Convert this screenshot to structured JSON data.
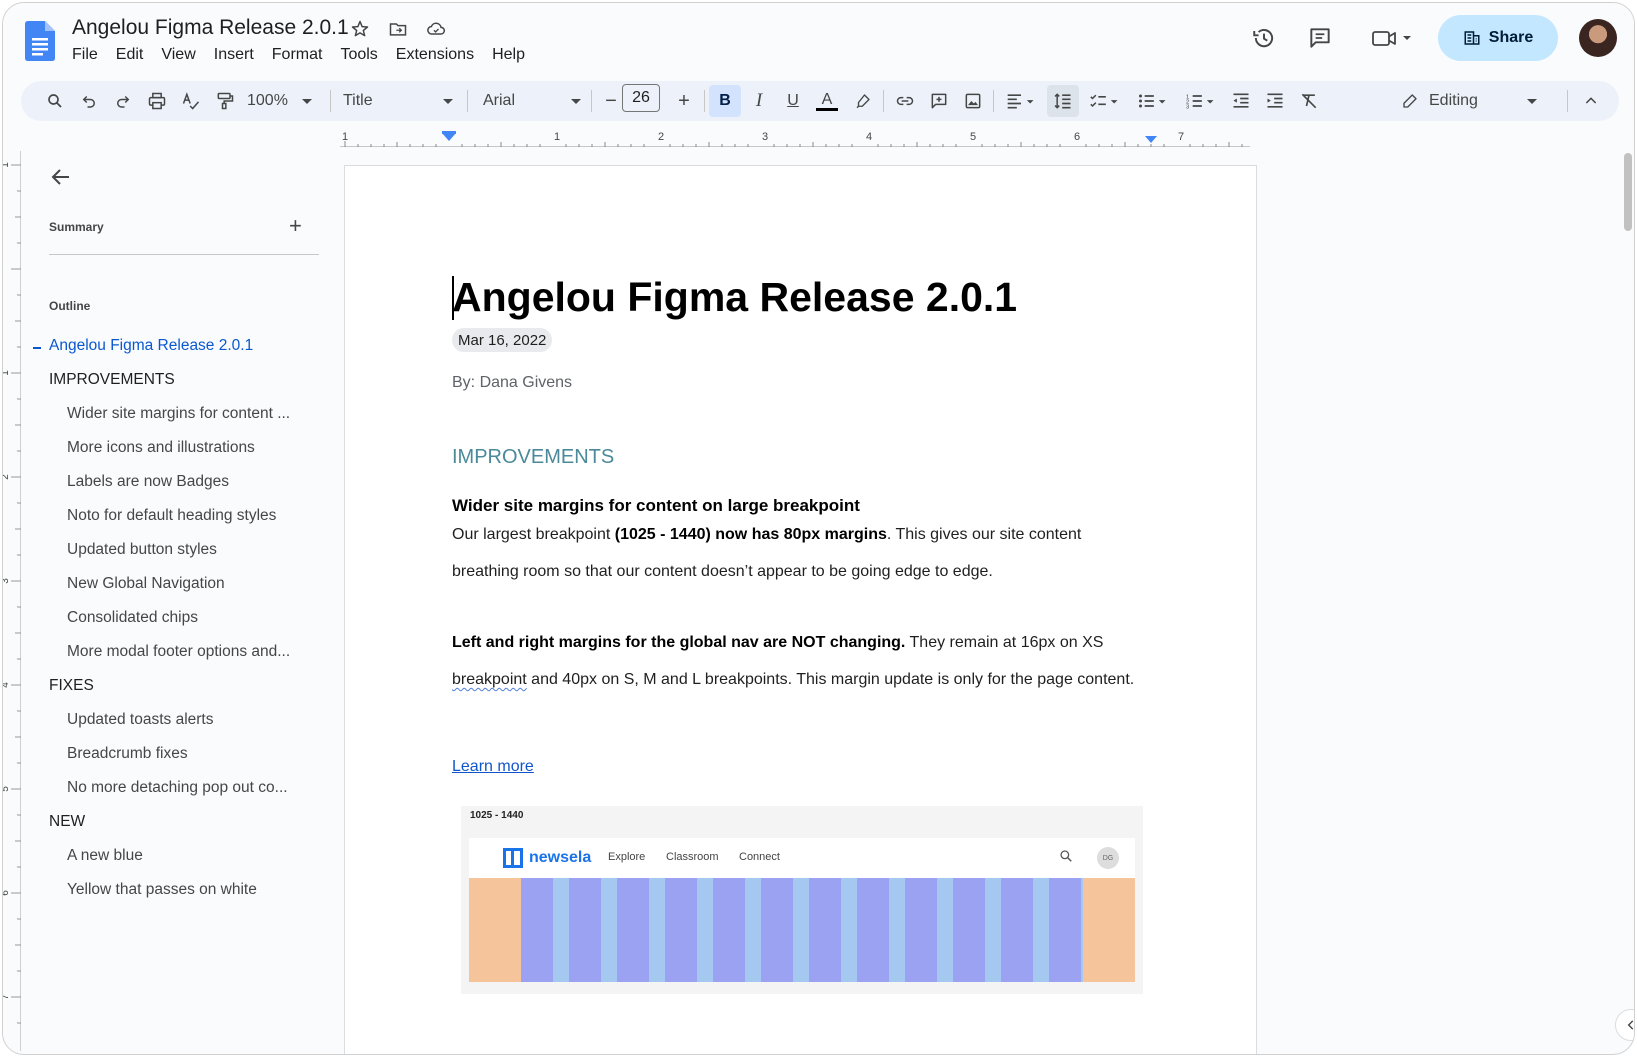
{
  "app": {
    "title": "Angelou Figma Release 2.0.1",
    "menu": [
      "File",
      "Edit",
      "View",
      "Insert",
      "Format",
      "Tools",
      "Extensions",
      "Help"
    ],
    "share_label": "Share",
    "colors": {
      "accent": "#0b57d0",
      "share_bg": "#c2e7ff",
      "toolbar_bg": "#edf2fa",
      "section_heading": "#4a8a9a",
      "link": "#1155cc"
    }
  },
  "toolbar": {
    "zoom": "100%",
    "style": "Title",
    "font": "Arial",
    "font_size": "26",
    "bold": "B",
    "italic": "I",
    "underline": "U",
    "text_color": "A",
    "mode": "Editing",
    "icons": [
      "search-icon",
      "undo-icon",
      "redo-icon",
      "print-icon",
      "spellcheck-icon",
      "paint-format-icon",
      "link-icon",
      "comment-add-icon",
      "image-icon",
      "align-left-icon",
      "line-spacing-icon",
      "checklist-icon",
      "bulleted-list-icon",
      "numbered-list-icon",
      "indent-decrease-icon",
      "indent-increase-icon",
      "clear-formatting-icon",
      "pencil-icon",
      "collapse-up-icon"
    ]
  },
  "ruler": {
    "marks": [
      "1",
      "1",
      "2",
      "3",
      "4",
      "5",
      "6",
      "7"
    ],
    "left_marks": [
      "1",
      "1",
      "2",
      "3",
      "4",
      "5",
      "6",
      "7"
    ]
  },
  "outline_panel": {
    "summary_label": "Summary",
    "add_label": "+",
    "outline_label": "Outline",
    "items": [
      {
        "label": "Angelou Figma Release 2.0.1",
        "level": 1,
        "active": true
      },
      {
        "label": "IMPROVEMENTS",
        "level": 1
      },
      {
        "label": "Wider site margins for content ...",
        "level": 2
      },
      {
        "label": "More icons and illustrations",
        "level": 2
      },
      {
        "label": "Labels are now Badges",
        "level": 2
      },
      {
        "label": "Noto for default heading styles",
        "level": 2
      },
      {
        "label": "Updated button styles",
        "level": 2
      },
      {
        "label": "New Global Navigation",
        "level": 2
      },
      {
        "label": "Consolidated chips",
        "level": 2
      },
      {
        "label": "More modal footer options and...",
        "level": 2
      },
      {
        "label": "FIXES",
        "level": 1
      },
      {
        "label": "Updated toasts alerts",
        "level": 2
      },
      {
        "label": "Breadcrumb fixes",
        "level": 2
      },
      {
        "label": "No more detaching pop out co...",
        "level": 2
      },
      {
        "label": "NEW",
        "level": 1
      },
      {
        "label": "A new blue",
        "level": 2
      },
      {
        "label": "Yellow that passes on white",
        "level": 2
      }
    ]
  },
  "document": {
    "title": "Angelou Figma Release 2.0.1",
    "date": "Mar 16, 2022",
    "byline": "By: Dana Givens",
    "section": "IMPROVEMENTS",
    "subheading": "Wider site margins for content on large breakpoint",
    "p1_a": "Our largest breakpoint ",
    "p1_b": "(1025 - 1440) now has 80px margins",
    "p1_c": ". This gives our site content breathing room so that our content doesn’t appear to be going edge to edge.",
    "p2_a": "Left and right margins for the global nav are NOT changing.",
    "p2_b": " They remain at 16px on XS ",
    "p2_c": "breakpoint",
    "p2_d": " and 40px on S, M and L breakpoints. This margin update is only for the page content.",
    "learn_more": "Learn more",
    "embed": {
      "label": "1025 - 1440",
      "brand": "newsela",
      "nav": [
        "Explore",
        "Classroom",
        "Connect"
      ],
      "avatar": "DG"
    }
  }
}
